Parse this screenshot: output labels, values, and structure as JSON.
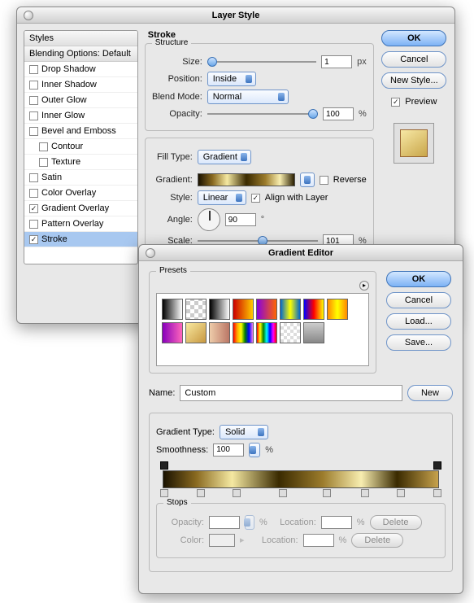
{
  "layer_style": {
    "title": "Layer Style",
    "sidebar": {
      "header": "Styles",
      "blending": "Blending Options: Default",
      "items": [
        {
          "label": "Drop Shadow",
          "checked": false,
          "sub": false
        },
        {
          "label": "Inner Shadow",
          "checked": false,
          "sub": false
        },
        {
          "label": "Outer Glow",
          "checked": false,
          "sub": false
        },
        {
          "label": "Inner Glow",
          "checked": false,
          "sub": false
        },
        {
          "label": "Bevel and Emboss",
          "checked": false,
          "sub": false
        },
        {
          "label": "Contour",
          "checked": false,
          "sub": true
        },
        {
          "label": "Texture",
          "checked": false,
          "sub": true
        },
        {
          "label": "Satin",
          "checked": false,
          "sub": false
        },
        {
          "label": "Color Overlay",
          "checked": false,
          "sub": false
        },
        {
          "label": "Gradient Overlay",
          "checked": true,
          "sub": false
        },
        {
          "label": "Pattern Overlay",
          "checked": false,
          "sub": false
        },
        {
          "label": "Stroke",
          "checked": true,
          "sub": false,
          "selected": true
        }
      ]
    },
    "panel_title": "Stroke",
    "structure": {
      "legend": "Structure",
      "size": {
        "label": "Size:",
        "value": "1",
        "unit": "px"
      },
      "position": {
        "label": "Position:",
        "value": "Inside"
      },
      "blendmode": {
        "label": "Blend Mode:",
        "value": "Normal"
      },
      "opacity": {
        "label": "Opacity:",
        "value": "100",
        "unit": "%"
      }
    },
    "filltype": {
      "label": "Fill Type:",
      "value": "Gradient"
    },
    "gradient": {
      "label": "Gradient:",
      "reverse": {
        "label": "Reverse",
        "checked": false
      },
      "style": {
        "label": "Style:",
        "value": "Linear"
      },
      "align": {
        "label": "Align with Layer",
        "checked": true
      },
      "angle": {
        "label": "Angle:",
        "value": "90",
        "unit": "°"
      },
      "scale": {
        "label": "Scale:",
        "value": "101",
        "unit": "%"
      }
    },
    "buttons": {
      "ok": "OK",
      "cancel": "Cancel",
      "newstyle": "New Style...",
      "preview": "Preview"
    }
  },
  "gradient_editor": {
    "title": "Gradient Editor",
    "presets_label": "Presets",
    "presets": [
      "linear-gradient(90deg,#000,#fff)",
      "repeating-conic-gradient(#ccc 0 25%,#fff 0 50%) 0/10px 10px",
      "linear-gradient(90deg,#000,#fff)",
      "linear-gradient(90deg,#c00,#fc0)",
      "linear-gradient(90deg,#80d,#f60)",
      "linear-gradient(90deg,#06c,#ff0,#06c)",
      "linear-gradient(90deg,#00f,#f00,#ff0)",
      "linear-gradient(90deg,#f80,#ff0,#f80)",
      "linear-gradient(90deg,#80b,#f6b)",
      "linear-gradient(135deg,#f8e8a0,#c89840)",
      "linear-gradient(90deg,#eca,#b76)",
      "linear-gradient(90deg,red,orange,yellow,green,blue,violet)",
      "linear-gradient(90deg,red,yellow,green,cyan,blue,magenta,red)",
      "repeating-conic-gradient(#ddd 0 25%,#fff 0 50%) 0/8px 8px",
      "linear-gradient(#ccc,#888)"
    ],
    "name": {
      "label": "Name:",
      "value": "Custom"
    },
    "new_btn": "New",
    "gradient_type": {
      "label": "Gradient Type:",
      "value": "Solid"
    },
    "smoothness": {
      "label": "Smoothness:",
      "value": "100",
      "unit": "%"
    },
    "stops": {
      "legend": "Stops",
      "opacity": {
        "label": "Opacity:",
        "value": "",
        "unit": "%"
      },
      "opacity_loc": {
        "label": "Location:",
        "value": "",
        "unit": "%"
      },
      "color": {
        "label": "Color:",
        "value": ""
      },
      "color_loc": {
        "label": "Location:",
        "value": "",
        "unit": "%"
      },
      "delete": "Delete"
    },
    "buttons": {
      "ok": "OK",
      "cancel": "Cancel",
      "load": "Load...",
      "save": "Save..."
    }
  }
}
